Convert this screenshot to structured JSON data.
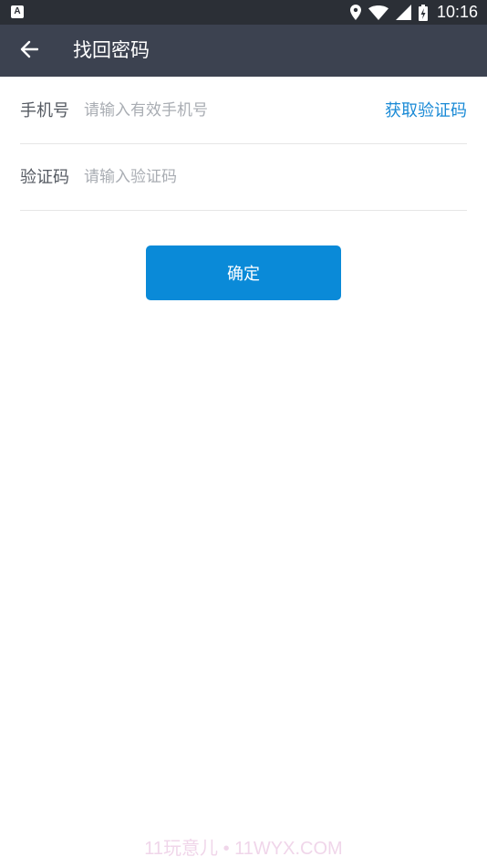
{
  "status_bar": {
    "left_icon": "A",
    "time": "10:16",
    "icons": [
      "location-icon",
      "wifi-icon",
      "signal-icon",
      "battery-charging-icon"
    ]
  },
  "app_bar": {
    "back_icon": "arrow-left-icon",
    "title": "找回密码"
  },
  "form": {
    "phone": {
      "label": "手机号",
      "placeholder": "请输入有效手机号",
      "value": "",
      "get_code_label": "获取验证码"
    },
    "code": {
      "label": "验证码",
      "placeholder": "请输入验证码",
      "value": ""
    },
    "confirm_label": "确定"
  },
  "watermark": "11玩意儿 • 11WYX.COM",
  "colors": {
    "status_bar": "#2b2f36",
    "app_bar": "#3c4250",
    "accent": "#0a8ad8",
    "link": "#1a8ad6",
    "divider": "#e6e6e6"
  }
}
